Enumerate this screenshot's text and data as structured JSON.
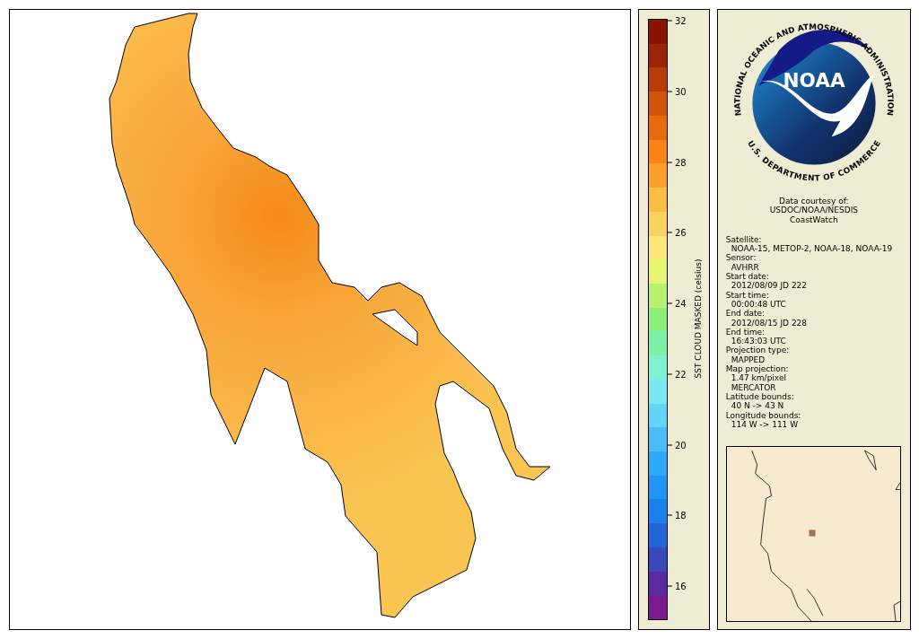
{
  "legend": {
    "label": "SST CLOUD MASKED (celsius)",
    "ticks": [
      "32",
      "30",
      "28",
      "26",
      "24",
      "22",
      "20",
      "18",
      "16"
    ]
  },
  "logo": {
    "arc_top": "NATIONAL OCEANIC AND ATMOSPHERIC ADMINISTRATION",
    "arc_bottom": "U.S. DEPARTMENT OF COMMERCE",
    "center": "NOAA"
  },
  "credit": [
    "Data courtesy of:",
    "USDOC/NOAA/NESDIS",
    "CoastWatch"
  ],
  "metadata": [
    {
      "label": "Satellite:",
      "values": [
        "NOAA-15, METOP-2, NOAA-18, NOAA-19"
      ]
    },
    {
      "label": "Sensor:",
      "values": [
        "AVHRR"
      ]
    },
    {
      "label": "Start date:",
      "values": [
        "2012/08/09 JD 222"
      ]
    },
    {
      "label": "Start time:",
      "values": [
        "00:00:48 UTC"
      ]
    },
    {
      "label": "End date:",
      "values": [
        "2012/08/15 JD 228"
      ]
    },
    {
      "label": "End time:",
      "values": [
        "16:43:03 UTC"
      ]
    },
    {
      "label": "Projection type:",
      "values": [
        "MAPPED"
      ]
    },
    {
      "label": "Map projection:",
      "values": [
        "1.47 km/pixel",
        "MERCATOR"
      ]
    },
    {
      "label": "Latitude bounds:",
      "values": [
        "40 N -> 43 N"
      ]
    },
    {
      "label": "Longitude bounds:",
      "values": [
        "114 W -> 111 W"
      ]
    }
  ]
}
